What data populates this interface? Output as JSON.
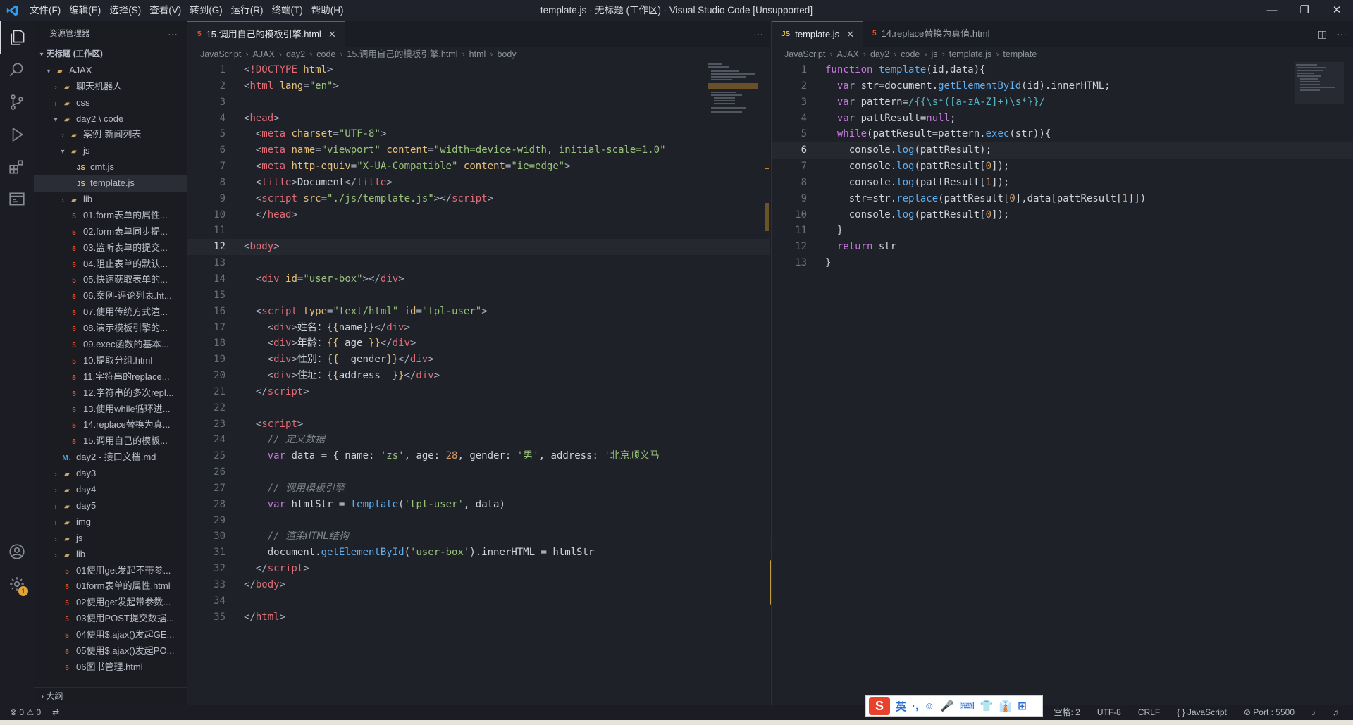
{
  "window": {
    "title": "template.js - 无标题 (工作区) - Visual Studio Code [Unsupported]",
    "menu": [
      "文件(F)",
      "编辑(E)",
      "选择(S)",
      "查看(V)",
      "转到(G)",
      "运行(R)",
      "终端(T)",
      "帮助(H)"
    ],
    "controls": [
      "—",
      "❐",
      "✕"
    ]
  },
  "activity": [
    "explorer-icon",
    "search-icon",
    "source-control-icon",
    "run-debug-icon",
    "extensions-icon",
    "remote-explorer-icon",
    "account-icon",
    "settings-gear-icon"
  ],
  "sidebar": {
    "title": "资源管理器",
    "more": "···",
    "workspace": "无标题 (工作区)",
    "items": [
      {
        "label": "AJAX",
        "type": "folder",
        "indent": 1,
        "open": true
      },
      {
        "label": "聊天机器人",
        "type": "folder",
        "indent": 2,
        "open": false
      },
      {
        "label": "css",
        "type": "folder",
        "indent": 2,
        "open": false
      },
      {
        "label": "day2 \\ code",
        "type": "folder",
        "indent": 2,
        "open": true
      },
      {
        "label": "案例-新闻列表",
        "type": "folder",
        "indent": 3,
        "open": false
      },
      {
        "label": "js",
        "type": "folder",
        "indent": 3,
        "open": true
      },
      {
        "label": "cmt.js",
        "type": "js",
        "indent": 4
      },
      {
        "label": "template.js",
        "type": "js",
        "indent": 4,
        "selected": true
      },
      {
        "label": "lib",
        "type": "folder",
        "indent": 3,
        "open": false
      },
      {
        "label": "01.form表单的属性...",
        "type": "html",
        "indent": 3
      },
      {
        "label": "02.form表单同步提...",
        "type": "html",
        "indent": 3
      },
      {
        "label": "03.监听表单的提交...",
        "type": "html",
        "indent": 3
      },
      {
        "label": "04.阻止表单的默认...",
        "type": "html",
        "indent": 3
      },
      {
        "label": "05.快速获取表单的...",
        "type": "html",
        "indent": 3
      },
      {
        "label": "06.案例-评论列表.ht...",
        "type": "html",
        "indent": 3
      },
      {
        "label": "07.使用传统方式渲...",
        "type": "html",
        "indent": 3
      },
      {
        "label": "08.演示模板引擎的...",
        "type": "html",
        "indent": 3
      },
      {
        "label": "09.exec函数的基本...",
        "type": "html",
        "indent": 3
      },
      {
        "label": "10.提取分组.html",
        "type": "html",
        "indent": 3
      },
      {
        "label": "11.字符串的replace...",
        "type": "html",
        "indent": 3
      },
      {
        "label": "12.字符串的多次repl...",
        "type": "html",
        "indent": 3
      },
      {
        "label": "13.使用while循环进...",
        "type": "html",
        "indent": 3
      },
      {
        "label": "14.replace替换为真...",
        "type": "html",
        "indent": 3
      },
      {
        "label": "15.调用自己的模板...",
        "type": "html",
        "indent": 3
      },
      {
        "label": "day2 - 接口文档.md",
        "type": "md",
        "indent": 2
      },
      {
        "label": "day3",
        "type": "folder",
        "indent": 2,
        "open": false
      },
      {
        "label": "day4",
        "type": "folder",
        "indent": 2,
        "open": false
      },
      {
        "label": "day5",
        "type": "folder",
        "indent": 2,
        "open": false
      },
      {
        "label": "img",
        "type": "folder",
        "indent": 2,
        "open": false
      },
      {
        "label": "js",
        "type": "folder",
        "indent": 2,
        "open": false
      },
      {
        "label": "lib",
        "type": "folder",
        "indent": 2,
        "open": false
      },
      {
        "label": "01使用get发起不带参...",
        "type": "html",
        "indent": 2
      },
      {
        "label": "01form表单的属性.html",
        "type": "html",
        "indent": 2
      },
      {
        "label": "02使用get发起带参数...",
        "type": "html",
        "indent": 2
      },
      {
        "label": "03使用POST提交数据...",
        "type": "html",
        "indent": 2
      },
      {
        "label": "04使用$.ajax()发起GE...",
        "type": "html",
        "indent": 2
      },
      {
        "label": "05使用$.ajax()发起PO...",
        "type": "html",
        "indent": 2
      },
      {
        "label": "06图书管理.html",
        "type": "html",
        "indent": 2
      }
    ],
    "outline": "大纲"
  },
  "left_editor": {
    "tabs": [
      {
        "label": "15.调用自己的模板引擎.html",
        "type": "html",
        "active": true
      }
    ],
    "crumbs": [
      "JavaScript",
      "AJAX",
      "day2",
      "code",
      "15.调用自己的模板引擎.html",
      "html",
      "body"
    ],
    "current_line": 12,
    "lines": [
      [
        [
          "t-pun",
          "<"
        ],
        [
          "t-tag",
          "!DOCTYPE "
        ],
        [
          "t-attr",
          "html"
        ],
        [
          "t-pun",
          ">"
        ]
      ],
      [
        [
          "t-pun",
          "<"
        ],
        [
          "t-tag",
          "html "
        ],
        [
          "t-attr",
          "lang"
        ],
        [
          "t-pun",
          "="
        ],
        [
          "t-str",
          "\"en\""
        ],
        [
          "t-pun",
          ">"
        ]
      ],
      [],
      [
        [
          "t-pun",
          "<"
        ],
        [
          "t-tag",
          "head"
        ],
        [
          "t-pun",
          ">"
        ]
      ],
      [
        [
          "",
          "  "
        ],
        [
          "t-pun",
          "<"
        ],
        [
          "t-tag",
          "meta "
        ],
        [
          "t-attr",
          "charset"
        ],
        [
          "t-pun",
          "="
        ],
        [
          "t-str",
          "\"UTF-8\""
        ],
        [
          "t-pun",
          ">"
        ]
      ],
      [
        [
          "",
          "  "
        ],
        [
          "t-pun",
          "<"
        ],
        [
          "t-tag",
          "meta "
        ],
        [
          "t-attr",
          "name"
        ],
        [
          "t-pun",
          "="
        ],
        [
          "t-str",
          "\"viewport\" "
        ],
        [
          "t-attr",
          "content"
        ],
        [
          "t-pun",
          "="
        ],
        [
          "t-str",
          "\"width=device-width, initial-scale=1.0\""
        ]
      ],
      [
        [
          "",
          "  "
        ],
        [
          "t-pun",
          "<"
        ],
        [
          "t-tag",
          "meta "
        ],
        [
          "t-attr",
          "http-equiv"
        ],
        [
          "t-pun",
          "="
        ],
        [
          "t-str",
          "\"X-UA-Compatible\" "
        ],
        [
          "t-attr",
          "content"
        ],
        [
          "t-pun",
          "="
        ],
        [
          "t-str",
          "\"ie=edge\""
        ],
        [
          "t-pun",
          ">"
        ]
      ],
      [
        [
          "",
          "  "
        ],
        [
          "t-pun",
          "<"
        ],
        [
          "t-tag",
          "title"
        ],
        [
          "t-pun",
          ">"
        ],
        [
          "",
          "Document"
        ],
        [
          "t-pun",
          "</"
        ],
        [
          "t-tag",
          "title"
        ],
        [
          "t-pun",
          ">"
        ]
      ],
      [
        [
          "",
          "  "
        ],
        [
          "t-pun",
          "<"
        ],
        [
          "t-tag",
          "script "
        ],
        [
          "t-attr",
          "src"
        ],
        [
          "t-pun",
          "="
        ],
        [
          "t-str",
          "\"./js/template.js\""
        ],
        [
          "t-pun",
          "></"
        ],
        [
          "t-tag",
          "script"
        ],
        [
          "t-pun",
          ">"
        ]
      ],
      [
        [
          "",
          "  "
        ],
        [
          "t-pun",
          "</"
        ],
        [
          "t-tag",
          "head"
        ],
        [
          "t-pun",
          ">"
        ]
      ],
      [],
      [
        [
          "t-pun",
          "<"
        ],
        [
          "t-tag",
          "body"
        ],
        [
          "t-pun",
          ">"
        ]
      ],
      [],
      [
        [
          "",
          "  "
        ],
        [
          "t-pun",
          "<"
        ],
        [
          "t-tag",
          "div "
        ],
        [
          "t-attr",
          "id"
        ],
        [
          "t-pun",
          "="
        ],
        [
          "t-str",
          "\"user-box\""
        ],
        [
          "t-pun",
          "></"
        ],
        [
          "t-tag",
          "div"
        ],
        [
          "t-pun",
          ">"
        ]
      ],
      [],
      [
        [
          "",
          "  "
        ],
        [
          "t-pun",
          "<"
        ],
        [
          "t-tag",
          "script "
        ],
        [
          "t-attr",
          "type"
        ],
        [
          "t-pun",
          "="
        ],
        [
          "t-str",
          "\"text/html\" "
        ],
        [
          "t-attr",
          "id"
        ],
        [
          "t-pun",
          "="
        ],
        [
          "t-str",
          "\"tpl-user\""
        ],
        [
          "t-pun",
          ">"
        ]
      ],
      [
        [
          "",
          "    "
        ],
        [
          "t-pun",
          "<"
        ],
        [
          "t-tag",
          "div"
        ],
        [
          "t-pun",
          ">"
        ],
        [
          "",
          "姓名："
        ],
        [
          "t-var",
          "{{"
        ],
        [
          "",
          "name"
        ],
        [
          "t-var",
          "}}"
        ],
        [
          "t-pun",
          "</"
        ],
        [
          "t-tag",
          "div"
        ],
        [
          "t-pun",
          ">"
        ]
      ],
      [
        [
          "",
          "    "
        ],
        [
          "t-pun",
          "<"
        ],
        [
          "t-tag",
          "div"
        ],
        [
          "t-pun",
          ">"
        ],
        [
          "",
          "年龄："
        ],
        [
          "t-var",
          "{{"
        ],
        [
          "",
          " age "
        ],
        [
          "t-var",
          "}}"
        ],
        [
          "t-pun",
          "</"
        ],
        [
          "t-tag",
          "div"
        ],
        [
          "t-pun",
          ">"
        ]
      ],
      [
        [
          "",
          "    "
        ],
        [
          "t-pun",
          "<"
        ],
        [
          "t-tag",
          "div"
        ],
        [
          "t-pun",
          ">"
        ],
        [
          "",
          "性别："
        ],
        [
          "t-var",
          "{{"
        ],
        [
          "",
          "  gender"
        ],
        [
          "t-var",
          "}}"
        ],
        [
          "t-pun",
          "</"
        ],
        [
          "t-tag",
          "div"
        ],
        [
          "t-pun",
          ">"
        ]
      ],
      [
        [
          "",
          "    "
        ],
        [
          "t-pun",
          "<"
        ],
        [
          "t-tag",
          "div"
        ],
        [
          "t-pun",
          ">"
        ],
        [
          "",
          "住址："
        ],
        [
          "t-var",
          "{{"
        ],
        [
          "",
          "address  "
        ],
        [
          "t-var",
          "}}"
        ],
        [
          "t-pun",
          "</"
        ],
        [
          "t-tag",
          "div"
        ],
        [
          "t-pun",
          ">"
        ]
      ],
      [
        [
          "",
          "  "
        ],
        [
          "t-pun",
          "</"
        ],
        [
          "t-tag",
          "script"
        ],
        [
          "t-pun",
          ">"
        ]
      ],
      [],
      [
        [
          "",
          "  "
        ],
        [
          "t-pun",
          "<"
        ],
        [
          "t-tag",
          "script"
        ],
        [
          "t-pun",
          ">"
        ]
      ],
      [
        [
          "",
          "    "
        ],
        [
          "t-com",
          "// 定义数据"
        ]
      ],
      [
        [
          "",
          "    "
        ],
        [
          "t-kw",
          "var "
        ],
        [
          "",
          "data = { name: "
        ],
        [
          "t-str",
          "'zs'"
        ],
        [
          "",
          ", age: "
        ],
        [
          "t-num",
          "28"
        ],
        [
          "",
          ", gender: "
        ],
        [
          "t-str",
          "'男'"
        ],
        [
          "",
          ", address: "
        ],
        [
          "t-str",
          "'北京顺义马"
        ]
      ],
      [],
      [
        [
          "",
          "    "
        ],
        [
          "t-com",
          "// 调用模板引擎"
        ]
      ],
      [
        [
          "",
          "    "
        ],
        [
          "t-kw",
          "var "
        ],
        [
          "",
          "htmlStr = "
        ],
        [
          "t-fn",
          "template"
        ],
        [
          "",
          "("
        ],
        [
          "t-str",
          "'tpl-user'"
        ],
        [
          "",
          ", data)"
        ]
      ],
      [],
      [
        [
          "",
          "    "
        ],
        [
          "t-com",
          "// 渲染HTML结构"
        ]
      ],
      [
        [
          "",
          "    "
        ],
        [
          "",
          "document."
        ],
        [
          "t-fn",
          "getElementById"
        ],
        [
          "",
          "("
        ],
        [
          "t-str",
          "'user-box'"
        ],
        [
          "",
          ").innerHTML = htmlStr"
        ]
      ],
      [
        [
          "",
          "  "
        ],
        [
          "t-pun",
          "</"
        ],
        [
          "t-tag",
          "script"
        ],
        [
          "t-pun",
          ">"
        ]
      ],
      [
        [
          "t-pun",
          "</"
        ],
        [
          "t-tag",
          "body"
        ],
        [
          "t-pun",
          ">"
        ]
      ],
      [],
      [
        [
          "t-pun",
          "</"
        ],
        [
          "t-tag",
          "html"
        ],
        [
          "t-pun",
          ">"
        ]
      ]
    ]
  },
  "right_editor": {
    "tabs": [
      {
        "label": "template.js",
        "type": "js",
        "active": true
      },
      {
        "label": "14.replace替换为真值.html",
        "type": "html",
        "active": false
      }
    ],
    "crumbs": [
      "JavaScript",
      "AJAX",
      "day2",
      "code",
      "js",
      "template.js",
      "template"
    ],
    "current_line": 6,
    "lines": [
      [
        [
          "t-kw",
          "function "
        ],
        [
          "t-fn",
          "template"
        ],
        [
          "",
          "(id,data){"
        ]
      ],
      [
        [
          "",
          "  "
        ],
        [
          "t-kw",
          "var "
        ],
        [
          "",
          "str=document."
        ],
        [
          "t-fn",
          "getElementById"
        ],
        [
          "",
          "(id).innerHTML;"
        ]
      ],
      [
        [
          "",
          "  "
        ],
        [
          "t-kw",
          "var "
        ],
        [
          "",
          "pattern="
        ],
        [
          "t-reg",
          "/{{\\s*([a-zA-Z]+)\\s*}}/"
        ]
      ],
      [
        [
          "",
          "  "
        ],
        [
          "t-kw",
          "var "
        ],
        [
          "",
          "pattResult="
        ],
        [
          "t-kw",
          "null"
        ],
        [
          "",
          ";"
        ]
      ],
      [
        [
          "",
          "  "
        ],
        [
          "t-kw",
          "while"
        ],
        [
          "",
          "(pattResult=pattern."
        ],
        [
          "t-fn",
          "exec"
        ],
        [
          "",
          "(str)){"
        ]
      ],
      [
        [
          "",
          "    console."
        ],
        [
          "t-fn",
          "log"
        ],
        [
          "",
          "(pattResult);"
        ]
      ],
      [
        [
          "",
          "    console."
        ],
        [
          "t-fn",
          "log"
        ],
        [
          "",
          "(pattResult["
        ],
        [
          "t-num",
          "0"
        ],
        [
          "",
          "]);"
        ]
      ],
      [
        [
          "",
          "    console."
        ],
        [
          "t-fn",
          "log"
        ],
        [
          "",
          "(pattResult["
        ],
        [
          "t-num",
          "1"
        ],
        [
          "",
          "]);"
        ]
      ],
      [
        [
          "",
          "    str=str."
        ],
        [
          "t-fn",
          "replace"
        ],
        [
          "",
          "(pattResult["
        ],
        [
          "t-num",
          "0"
        ],
        [
          "",
          "],data[pattResult["
        ],
        [
          "t-num",
          "1"
        ],
        [
          "",
          "]])"
        ]
      ],
      [
        [
          "",
          "    console."
        ],
        [
          "t-fn",
          "log"
        ],
        [
          "",
          "(pattResult["
        ],
        [
          "t-num",
          "0"
        ],
        [
          "",
          "]);"
        ]
      ],
      [
        [
          "",
          "  }"
        ]
      ],
      [
        [
          "",
          "  "
        ],
        [
          "t-kw",
          "return "
        ],
        [
          "",
          "str"
        ]
      ],
      [
        [
          "",
          "}"
        ]
      ]
    ]
  },
  "status": {
    "left": [
      "⊗ 0 ⚠ 0",
      "⇄"
    ],
    "right": [
      "空格: 2",
      "UTF-8",
      "CRLF",
      "{ } JavaScript",
      "⊘ Port : 5500",
      "♪",
      "♫"
    ]
  },
  "ime": {
    "logo": "S",
    "items": [
      "英",
      "·,",
      "☺",
      "🎤",
      "⌨",
      "👕",
      "👔",
      "⊞"
    ]
  },
  "colors": {
    "accent": "#2b6fb0",
    "html": "#e44d26",
    "js": "#e7c547",
    "folder": "#c9a56a"
  }
}
